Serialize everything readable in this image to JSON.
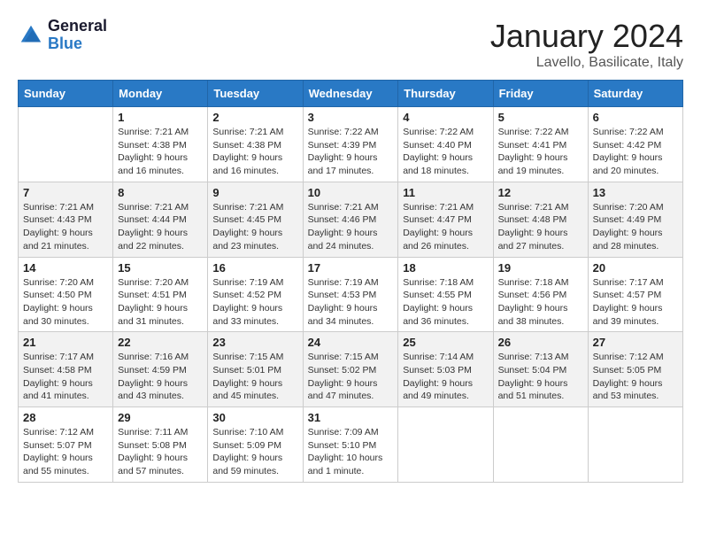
{
  "header": {
    "logo_general": "General",
    "logo_blue": "Blue",
    "month_title": "January 2024",
    "location": "Lavello, Basilicate, Italy"
  },
  "weekdays": [
    "Sunday",
    "Monday",
    "Tuesday",
    "Wednesday",
    "Thursday",
    "Friday",
    "Saturday"
  ],
  "weeks": [
    [
      {
        "day": "",
        "info": ""
      },
      {
        "day": "1",
        "info": "Sunrise: 7:21 AM\nSunset: 4:38 PM\nDaylight: 9 hours\nand 16 minutes."
      },
      {
        "day": "2",
        "info": "Sunrise: 7:21 AM\nSunset: 4:38 PM\nDaylight: 9 hours\nand 16 minutes."
      },
      {
        "day": "3",
        "info": "Sunrise: 7:22 AM\nSunset: 4:39 PM\nDaylight: 9 hours\nand 17 minutes."
      },
      {
        "day": "4",
        "info": "Sunrise: 7:22 AM\nSunset: 4:40 PM\nDaylight: 9 hours\nand 18 minutes."
      },
      {
        "day": "5",
        "info": "Sunrise: 7:22 AM\nSunset: 4:41 PM\nDaylight: 9 hours\nand 19 minutes."
      },
      {
        "day": "6",
        "info": "Sunrise: 7:22 AM\nSunset: 4:42 PM\nDaylight: 9 hours\nand 20 minutes."
      }
    ],
    [
      {
        "day": "7",
        "info": "Sunrise: 7:21 AM\nSunset: 4:43 PM\nDaylight: 9 hours\nand 21 minutes."
      },
      {
        "day": "8",
        "info": "Sunrise: 7:21 AM\nSunset: 4:44 PM\nDaylight: 9 hours\nand 22 minutes."
      },
      {
        "day": "9",
        "info": "Sunrise: 7:21 AM\nSunset: 4:45 PM\nDaylight: 9 hours\nand 23 minutes."
      },
      {
        "day": "10",
        "info": "Sunrise: 7:21 AM\nSunset: 4:46 PM\nDaylight: 9 hours\nand 24 minutes."
      },
      {
        "day": "11",
        "info": "Sunrise: 7:21 AM\nSunset: 4:47 PM\nDaylight: 9 hours\nand 26 minutes."
      },
      {
        "day": "12",
        "info": "Sunrise: 7:21 AM\nSunset: 4:48 PM\nDaylight: 9 hours\nand 27 minutes."
      },
      {
        "day": "13",
        "info": "Sunrise: 7:20 AM\nSunset: 4:49 PM\nDaylight: 9 hours\nand 28 minutes."
      }
    ],
    [
      {
        "day": "14",
        "info": "Sunrise: 7:20 AM\nSunset: 4:50 PM\nDaylight: 9 hours\nand 30 minutes."
      },
      {
        "day": "15",
        "info": "Sunrise: 7:20 AM\nSunset: 4:51 PM\nDaylight: 9 hours\nand 31 minutes."
      },
      {
        "day": "16",
        "info": "Sunrise: 7:19 AM\nSunset: 4:52 PM\nDaylight: 9 hours\nand 33 minutes."
      },
      {
        "day": "17",
        "info": "Sunrise: 7:19 AM\nSunset: 4:53 PM\nDaylight: 9 hours\nand 34 minutes."
      },
      {
        "day": "18",
        "info": "Sunrise: 7:18 AM\nSunset: 4:55 PM\nDaylight: 9 hours\nand 36 minutes."
      },
      {
        "day": "19",
        "info": "Sunrise: 7:18 AM\nSunset: 4:56 PM\nDaylight: 9 hours\nand 38 minutes."
      },
      {
        "day": "20",
        "info": "Sunrise: 7:17 AM\nSunset: 4:57 PM\nDaylight: 9 hours\nand 39 minutes."
      }
    ],
    [
      {
        "day": "21",
        "info": "Sunrise: 7:17 AM\nSunset: 4:58 PM\nDaylight: 9 hours\nand 41 minutes."
      },
      {
        "day": "22",
        "info": "Sunrise: 7:16 AM\nSunset: 4:59 PM\nDaylight: 9 hours\nand 43 minutes."
      },
      {
        "day": "23",
        "info": "Sunrise: 7:15 AM\nSunset: 5:01 PM\nDaylight: 9 hours\nand 45 minutes."
      },
      {
        "day": "24",
        "info": "Sunrise: 7:15 AM\nSunset: 5:02 PM\nDaylight: 9 hours\nand 47 minutes."
      },
      {
        "day": "25",
        "info": "Sunrise: 7:14 AM\nSunset: 5:03 PM\nDaylight: 9 hours\nand 49 minutes."
      },
      {
        "day": "26",
        "info": "Sunrise: 7:13 AM\nSunset: 5:04 PM\nDaylight: 9 hours\nand 51 minutes."
      },
      {
        "day": "27",
        "info": "Sunrise: 7:12 AM\nSunset: 5:05 PM\nDaylight: 9 hours\nand 53 minutes."
      }
    ],
    [
      {
        "day": "28",
        "info": "Sunrise: 7:12 AM\nSunset: 5:07 PM\nDaylight: 9 hours\nand 55 minutes."
      },
      {
        "day": "29",
        "info": "Sunrise: 7:11 AM\nSunset: 5:08 PM\nDaylight: 9 hours\nand 57 minutes."
      },
      {
        "day": "30",
        "info": "Sunrise: 7:10 AM\nSunset: 5:09 PM\nDaylight: 9 hours\nand 59 minutes."
      },
      {
        "day": "31",
        "info": "Sunrise: 7:09 AM\nSunset: 5:10 PM\nDaylight: 10 hours\nand 1 minute."
      },
      {
        "day": "",
        "info": ""
      },
      {
        "day": "",
        "info": ""
      },
      {
        "day": "",
        "info": ""
      }
    ]
  ]
}
